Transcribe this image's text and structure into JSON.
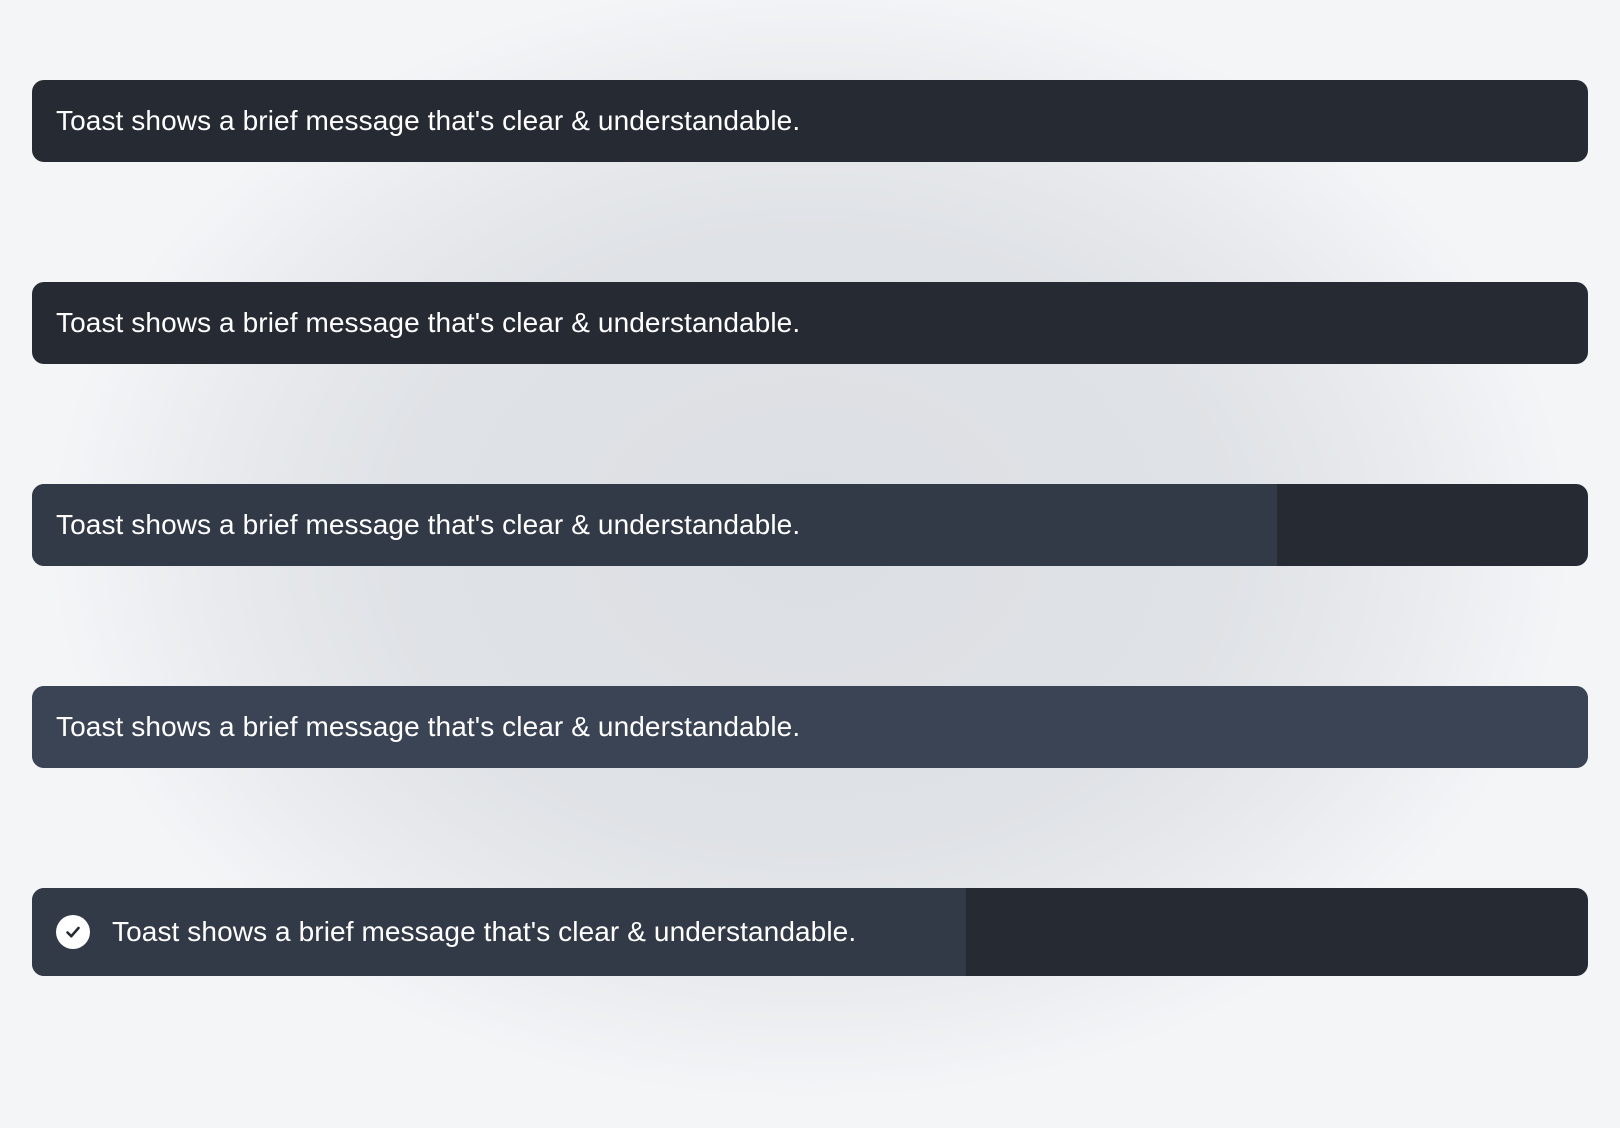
{
  "colors": {
    "toast_background": "#252a33",
    "toast_progress": "#333a47",
    "toast_hover_background": "#3b4455",
    "text": "#ffffff"
  },
  "toasts": [
    {
      "message": "Toast shows a brief message that's clear & understandable.",
      "progress": 0
    },
    {
      "message": "Toast shows a brief message that's clear & understandable.",
      "progress": 0
    },
    {
      "message": "Toast shows a brief message that's clear & understandable.",
      "progress": 0.8
    },
    {
      "message": "Toast shows a brief message that's clear & understandable.",
      "progress": 1
    },
    {
      "message": "Toast shows a brief message that's clear & understandable.",
      "progress": 0.6,
      "icon": "check-circle-icon"
    }
  ]
}
